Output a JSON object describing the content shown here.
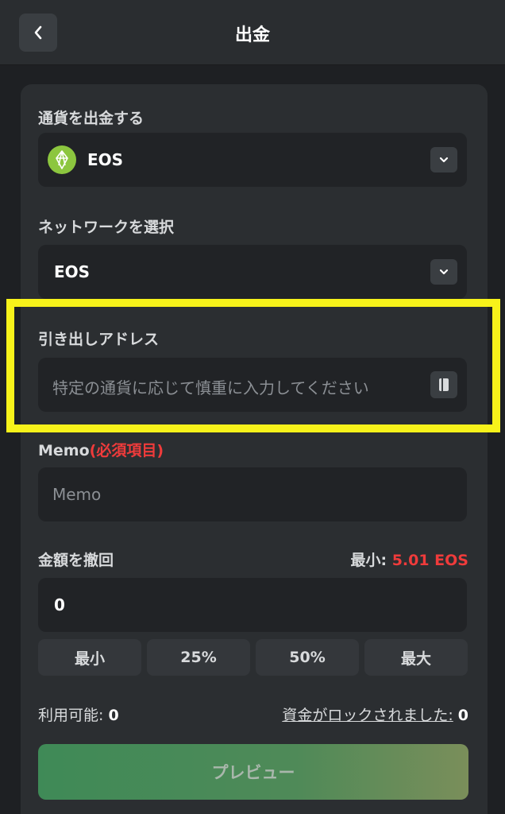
{
  "header": {
    "title": "出金"
  },
  "currency": {
    "label": "通貨を出金する",
    "selected": "EOS"
  },
  "network": {
    "label": "ネットワークを選択",
    "selected": "EOS"
  },
  "address": {
    "label": "引き出しアドレス",
    "placeholder": "特定の通貨に応じて慎重に入力してください"
  },
  "memo": {
    "label": "Memo",
    "required": "(必須項目)",
    "placeholder": "Memo"
  },
  "amount": {
    "label": "金額を撤回",
    "min_label": "最小:",
    "min_value": "5.01 EOS",
    "value": "0",
    "quick_buttons": [
      "最小",
      "25%",
      "50%",
      "最大"
    ]
  },
  "balance": {
    "available_label": "利用可能:",
    "available_value": "0",
    "locked_label": "資金がロックされました:",
    "locked_value": "0"
  },
  "preview_button": "プレビュー",
  "colors": {
    "accent_green": "#3f8a57",
    "required_red": "#ef3b3b",
    "highlight_yellow": "#f7f21a"
  }
}
